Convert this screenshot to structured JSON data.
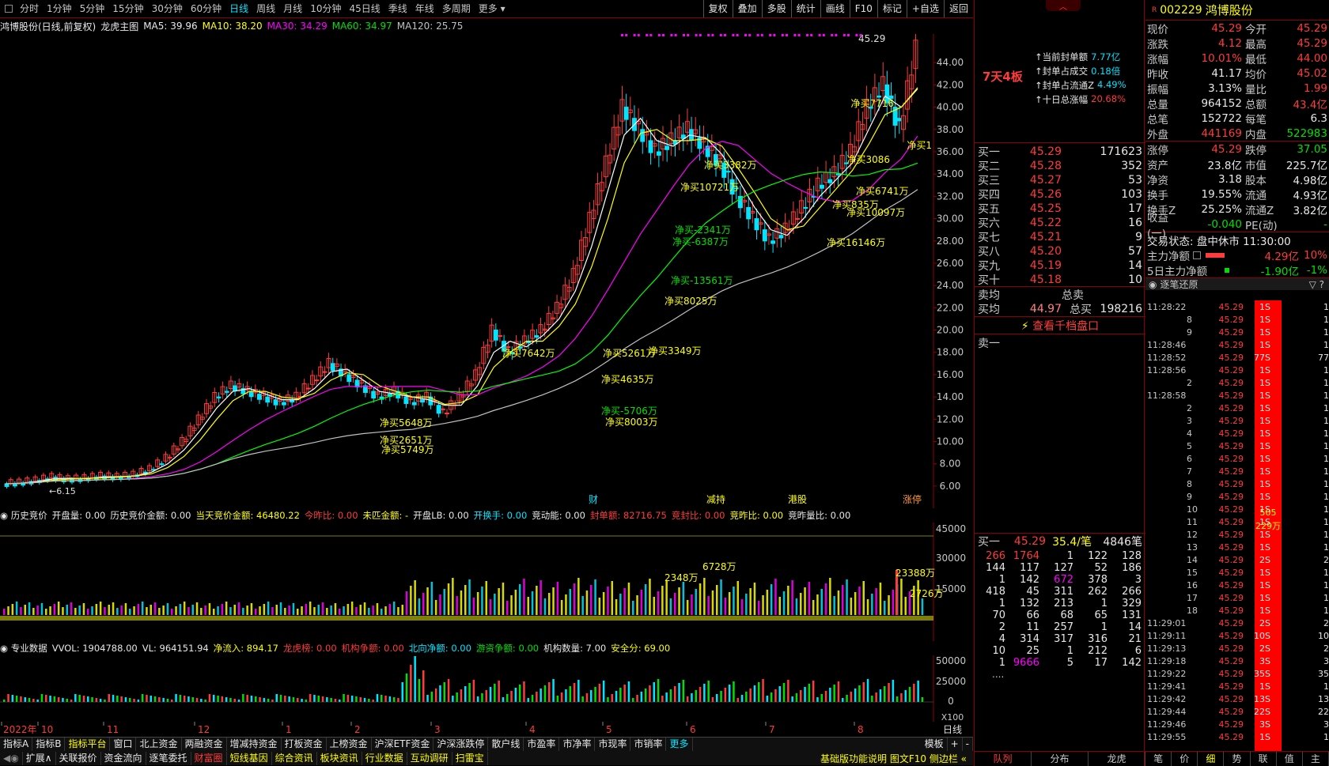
{
  "topbar": {
    "tabs": [
      "分时",
      "1分钟",
      "5分钟",
      "15分钟",
      "30分钟",
      "60分钟",
      "日线",
      "周线",
      "月线",
      "10分钟",
      "45日线",
      "季线",
      "年线",
      "多周期",
      "更多"
    ],
    "active": "日线",
    "tools": [
      "复权",
      "叠加",
      "多股",
      "统计",
      "画线",
      "F10",
      "标记",
      "+自选",
      "返回"
    ]
  },
  "chart_header": {
    "name": "鸿博股份(日线,前复权)",
    "main_indicator": "龙虎主图",
    "ma5": "MA5: 39.96",
    "ma10": "MA10: 38.20",
    "ma30": "MA30: 34.29",
    "ma60": "MA60: 34.97",
    "ma120": "MA120: 25.75"
  },
  "colors": {
    "ma5": "#ffffff",
    "ma10": "#ffff00",
    "ma30": "#ff00ff",
    "ma60": "#00ff00",
    "ma120": "#c0c0c0",
    "up": "#ff3b3b",
    "down": "#00e5ff"
  },
  "price_axis": [
    "44.00",
    "42.00",
    "40.00",
    "38.00",
    "36.00",
    "34.00",
    "32.00",
    "30.00",
    "28.00",
    "26.00",
    "24.00",
    "22.00",
    "20.00",
    "18.00",
    "16.00",
    "14.00",
    "12.00",
    "10.00",
    "8.00",
    "6.00"
  ],
  "chart_data": {
    "type": "candlestick",
    "y_range": [
      5,
      46
    ],
    "high_label": "45.29",
    "low_label": "6.15",
    "x_months": [
      "2022年",
      "10",
      "11",
      "12",
      "1",
      "2",
      "3",
      "4",
      "5",
      "6",
      "7",
      "8"
    ],
    "event_labels": [
      "财",
      "减持",
      "港股",
      "涨停"
    ],
    "close_approx": [
      6.2,
      6.3,
      6.5,
      6.8,
      6.6,
      6.7,
      6.9,
      6.8,
      7.0,
      7.5,
      8.5,
      10.0,
      12.0,
      14.0,
      15.0,
      14.5,
      14.0,
      13.5,
      14.0,
      15.5,
      17.0,
      16.0,
      15.0,
      14.0,
      14.5,
      13.5,
      14.0,
      12.5,
      14.0,
      16.0,
      20.0,
      18.0,
      19.0,
      20.0,
      22.0,
      25.0,
      30.0,
      35.0,
      40.0,
      38.0,
      36.0,
      37.0,
      38.0,
      36.5,
      35.0,
      32.0,
      30.0,
      28.0,
      29.0,
      31.0,
      33.0,
      34.0,
      36.0,
      40.0,
      42.0,
      38.0,
      45.29
    ]
  },
  "chart_annotations": [
    "净买7716",
    "净买1",
    "净买3086",
    "净买3382万",
    "净买10721万",
    "净买6741万",
    "净买835万",
    "净买10097万",
    "净买16146万",
    "净买-2341万",
    "净买-6387万",
    "净买-13561万",
    "净买8025万",
    "净买3349万",
    "净买5261万",
    "净买4635万",
    "净买8003万",
    "净买-5706万",
    "净买7642万",
    "净买5648万",
    "净买2651万",
    "净买5749万"
  ],
  "auction_row": {
    "title": "历史竞价",
    "items": [
      "开盘量: 0.00",
      "历史竞价金额: 0.00",
      "当天竞价金额: 46480.22",
      "今昨比: 0.00",
      "未匹金额: -",
      "开盘LB: 0.00",
      "开换手: 0.00",
      "竞动能: 0.00",
      "封单额: 82716.75",
      "竞封比: 0.00",
      "竞昨比: 0.00",
      "竞昨量比: 0.00"
    ]
  },
  "auction_axis": [
    "45000",
    "30000",
    "15000"
  ],
  "auction_labels": [
    "23388万",
    "2726万",
    "6728万",
    "2348万"
  ],
  "pro_row": {
    "title": "专业数据",
    "items": [
      "VVOL: 1904788.00",
      "VL: 964151.94",
      "净流入: 894.17",
      "龙虎榜: 0.00",
      "机构争额: 0.00",
      "北向净额: 0.00",
      "游资争额: 0.00",
      "机构数量: 7.00",
      "安全分: 69.00"
    ]
  },
  "vol_axis": [
    "50000",
    "25000",
    "0"
  ],
  "vol_unit": "X100",
  "date_axis": [
    "2022年",
    "10",
    "11",
    "12",
    "1",
    "2",
    "3",
    "4",
    "5",
    "6",
    "7",
    "8"
  ],
  "period_label": "日线",
  "bottom1": [
    "指标A",
    "指标B",
    "指标平台",
    "窗口",
    "北上资金",
    "两融资金",
    "增减持资金",
    "打板资金",
    "上榜资金",
    "沪深ETF资金",
    "沪深涨跌停",
    "散户线",
    "市盈率",
    "市净率",
    "市现率",
    "市销率",
    "更多"
  ],
  "bottom1_right": [
    "模板",
    "+",
    "-"
  ],
  "bottom2": [
    "扩展∧",
    "关联报价",
    "资金流向",
    "逐笔委托",
    "财富圈",
    "短线基因",
    "综合资讯",
    "板块资讯",
    "行业数据",
    "互动调研",
    "扫雷宝"
  ],
  "bottom2_right": "基础版功能说明 图文F10 侧边栏 «",
  "mid": {
    "board": "7天4板",
    "seal": [
      [
        "当前封单额",
        "7.77亿"
      ],
      [
        "封单占成交",
        "0.18倍"
      ],
      [
        "封单占流通Z",
        "4.49%"
      ],
      [
        "十日总涨幅",
        "20.68%"
      ]
    ],
    "bids": [
      [
        "买一",
        "45.29",
        "171623"
      ],
      [
        "买二",
        "45.28",
        "352"
      ],
      [
        "买三",
        "45.27",
        "53"
      ],
      [
        "买四",
        "45.26",
        "103"
      ],
      [
        "买五",
        "45.25",
        "17"
      ],
      [
        "买六",
        "45.22",
        "16"
      ],
      [
        "买七",
        "45.21",
        "9"
      ],
      [
        "买八",
        "45.20",
        "57"
      ],
      [
        "买九",
        "45.19",
        "14"
      ],
      [
        "买十",
        "45.18",
        "10"
      ]
    ],
    "avg_sell": "卖均",
    "avg_buy": "买均",
    "avg_buy_price": "44.97",
    "total_sell": "总卖",
    "total_buy": "总买",
    "total_buy_qty": "198216",
    "view_more": "查看千档盘口",
    "sell_one": "卖一",
    "queue_header": [
      "买一",
      "45.29",
      "35.4/笔",
      "4846笔"
    ],
    "queue": [
      [
        "266",
        "1764",
        "1",
        "122",
        "128"
      ],
      [
        "144",
        "117",
        "127",
        "52",
        "186"
      ],
      [
        "1",
        "142",
        "672",
        "378",
        "3"
      ],
      [
        "418",
        "45",
        "311",
        "262",
        "266"
      ],
      [
        "1",
        "132",
        "213",
        "1",
        "329"
      ],
      [
        "70",
        "66",
        "68",
        "65",
        "131"
      ],
      [
        "2",
        "11",
        "257",
        "1",
        "14"
      ],
      [
        "4",
        "314",
        "317",
        "316",
        "21"
      ],
      [
        "10",
        "25",
        "1",
        "212",
        "6"
      ],
      [
        "1",
        "9666",
        "5",
        "17",
        "142"
      ]
    ],
    "queue_more": "....",
    "bottom_tabs": [
      "队列",
      "分布",
      "龙虎"
    ]
  },
  "right": {
    "code": "002229",
    "name": "鸿博股份",
    "quote": [
      [
        "现价",
        "45.29",
        "今开",
        "45.29"
      ],
      [
        "涨跌",
        "4.12",
        "最高",
        "45.29"
      ],
      [
        "涨幅",
        "10.01%",
        "最低",
        "44.00"
      ],
      [
        "昨收",
        "41.17",
        "均价",
        "45.02"
      ],
      [
        "振幅",
        "3.13%",
        "量比",
        "1.99"
      ],
      [
        "总量",
        "964152",
        "总额",
        "43.4亿"
      ],
      [
        "总笔",
        "152722",
        "每笔",
        "6.3"
      ],
      [
        "外盘",
        "441169",
        "内盘",
        "522983"
      ]
    ],
    "fund": [
      [
        "涨停",
        "45.29",
        "跌停",
        "37.05"
      ],
      [
        "资产",
        "23.8亿",
        "市值",
        "225.7亿"
      ],
      [
        "净资",
        "3.18",
        "股本",
        "4.98亿"
      ],
      [
        "换手",
        "19.55%",
        "流通",
        "4.93亿"
      ],
      [
        "换手Z",
        "25.25%",
        "流通Z",
        "3.82亿"
      ],
      [
        "收益(一)",
        "-0.040",
        "PE(动)",
        "-"
      ]
    ],
    "status": "交易状态: 盘中休市 11:30:00",
    "main_flow": [
      "主力净额",
      "4.29亿",
      "10%"
    ],
    "flow5": [
      "5日主力净额",
      "-1.90亿",
      "-1%"
    ],
    "tick_title": "逐笔还原",
    "ticks": [
      [
        "11:28:22",
        "45.29",
        "1S",
        "1"
      ],
      [
        "8",
        "45.29",
        "1S",
        "1"
      ],
      [
        "9",
        "45.29",
        "1S",
        "1"
      ],
      [
        "11:28:46",
        "45.29",
        "1S",
        "1"
      ],
      [
        "11:28:52",
        "45.29",
        "77S",
        "77"
      ],
      [
        "11:28:56",
        "45.29",
        "1S",
        "1"
      ],
      [
        "2",
        "45.29",
        "1S",
        "1"
      ],
      [
        "11:28:58",
        "45.29",
        "1S",
        "1"
      ],
      [
        "2",
        "45.29",
        "1S",
        "1"
      ],
      [
        "3",
        "45.29",
        "1S",
        "1"
      ],
      [
        "4",
        "45.29",
        "1S",
        "1"
      ],
      [
        "5",
        "45.29",
        "1S",
        "1"
      ],
      [
        "6",
        "45.29",
        "1S",
        "1"
      ],
      [
        "7",
        "45.29",
        "1S",
        "1"
      ],
      [
        "8",
        "45.29",
        "1S",
        "1"
      ],
      [
        "9",
        "45.29",
        "1S",
        "1"
      ],
      [
        "10",
        "45.29",
        "1S",
        "1"
      ],
      [
        "11",
        "45.29",
        "1S",
        "1"
      ],
      [
        "12",
        "45.29",
        "1S",
        "1"
      ],
      [
        "13",
        "45.29",
        "1S",
        "1"
      ],
      [
        "14",
        "45.29",
        "2S",
        "2"
      ],
      [
        "15",
        "45.29",
        "1S",
        "1"
      ],
      [
        "16",
        "45.29",
        "1S",
        "1"
      ],
      [
        "17",
        "45.29",
        "1S",
        "1"
      ],
      [
        "18",
        "45.29",
        "1S",
        "1"
      ],
      [
        "11:29:01",
        "45.29",
        "2S",
        "2"
      ],
      [
        "11:29:11",
        "45.29",
        "10S",
        "10"
      ],
      [
        "11:29:13",
        "45.29",
        "2S",
        "2"
      ],
      [
        "11:29:18",
        "45.29",
        "3S",
        "3"
      ],
      [
        "11:29:22",
        "45.29",
        "35S",
        "35"
      ],
      [
        "11:29:41",
        "45.29",
        "1S",
        "1"
      ],
      [
        "11:29:42",
        "45.29",
        "13S",
        "13"
      ],
      [
        "11:29:44",
        "45.29",
        "22S",
        "22"
      ],
      [
        "11:29:46",
        "45.29",
        "3S",
        "3"
      ],
      [
        "11:29:55",
        "45.29",
        "1S",
        "1"
      ]
    ],
    "red_bar_label1": "505",
    "red_bar_label2": "229万",
    "bottom_tabs": [
      "笔",
      "价",
      "细",
      "势",
      "联",
      "值",
      "主"
    ]
  }
}
